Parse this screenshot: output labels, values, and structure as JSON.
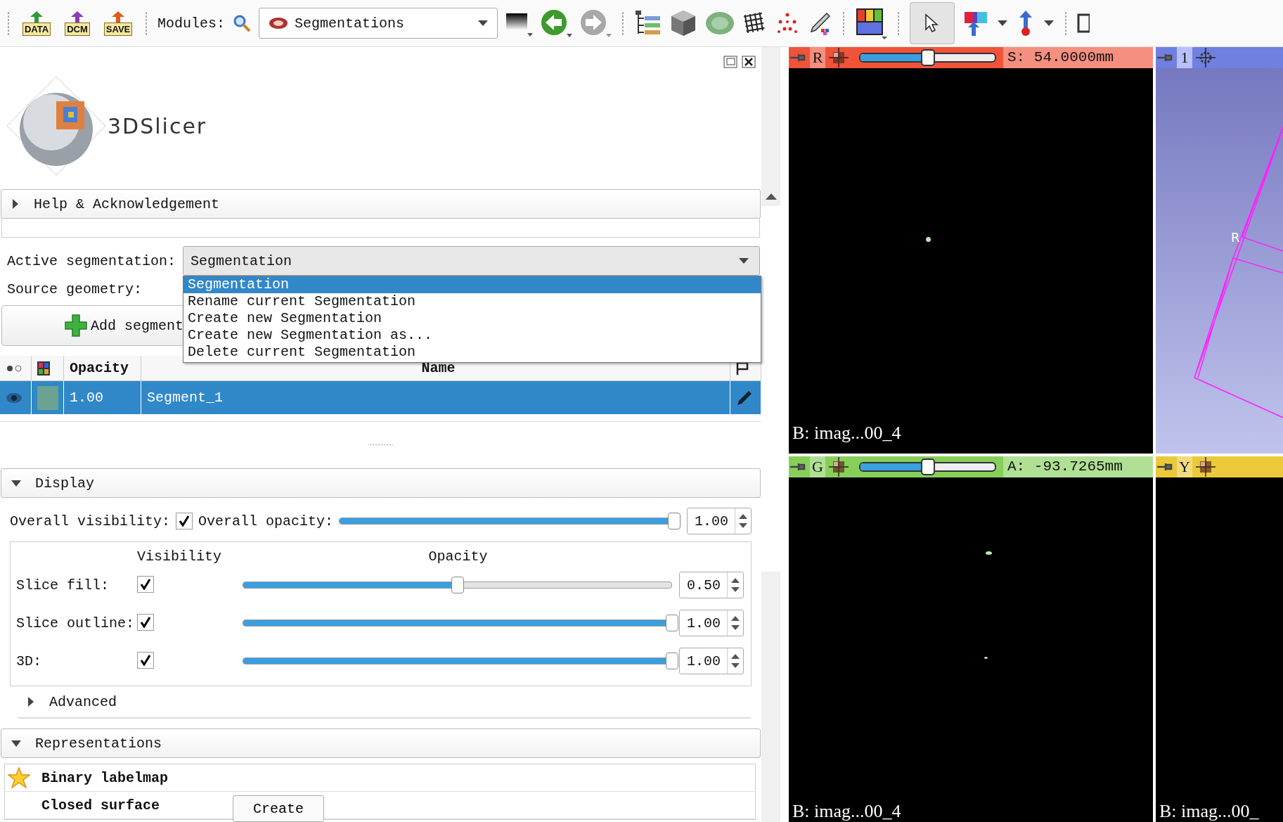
{
  "toolbar": {
    "file_buttons": [
      "DATA",
      "DCM",
      "SAVE"
    ],
    "modules_label": "Modules:",
    "module_selector": "Segmentations"
  },
  "module_panel": {
    "logo_text": "3DSlicer",
    "help_section": {
      "title": "Help & Acknowledgement",
      "expanded": false
    },
    "active_segmentation": {
      "label": "Active segmentation:",
      "value": "Segmentation"
    },
    "dropdown_options": [
      {
        "label": "Segmentation",
        "selected": true
      },
      {
        "label": "Rename current Segmentation",
        "selected": false
      },
      {
        "label": "Create new Segmentation",
        "selected": false
      },
      {
        "label": "Create new Segmentation as...",
        "selected": false
      },
      {
        "label": "Delete current Segmentation",
        "selected": false
      }
    ],
    "source_geometry_label": "Source geometry:",
    "add_segment_button": "Add segment",
    "segments_table": {
      "columns": [
        "Opacity",
        "Name"
      ],
      "rows": [
        {
          "visible": true,
          "color": "#6aa392",
          "opacity": "1.00",
          "name": "Segment_1",
          "selected": true
        }
      ]
    },
    "display": {
      "title": "Display",
      "expanded": true,
      "overall_visibility": {
        "label": "Overall visibility:",
        "checked": true
      },
      "overall_opacity": {
        "label": "Overall opacity:",
        "level": 1,
        "value": "1.00"
      },
      "headers": [
        "Visibility",
        "Opacity"
      ],
      "rows": [
        {
          "label": "Slice fill:",
          "checked": true,
          "level": 0.5,
          "value": "0.50"
        },
        {
          "label": "Slice outline:",
          "checked": true,
          "level": 1,
          "value": "1.00"
        },
        {
          "label": "3D:",
          "checked": true,
          "level": 1,
          "value": "1.00"
        }
      ],
      "advanced": {
        "title": "Advanced",
        "expanded": false
      }
    },
    "representations": {
      "title": "Representations",
      "expanded": true,
      "items": [
        {
          "name": "Binary labelmap",
          "master": true
        },
        {
          "name": "Closed surface",
          "master": false,
          "button": "Create"
        }
      ]
    }
  },
  "views": [
    {
      "kind": "slice",
      "letter": "R",
      "color": "#f0533a",
      "level": 0.5,
      "offset": "S: 54.0000mm",
      "volume_label": "B: imag...00_4"
    },
    {
      "kind": "render",
      "label": "1",
      "axis_label": "R"
    },
    {
      "kind": "slice",
      "letter": "G",
      "color": "#86d05a",
      "level": 0.5,
      "offset": "A: -93.7265mm",
      "volume_label": "B: imag...00_4"
    },
    {
      "kind": "slice",
      "letter": "Y",
      "color": "#ecc93a",
      "volume_label": "B: imag...00_"
    }
  ]
}
